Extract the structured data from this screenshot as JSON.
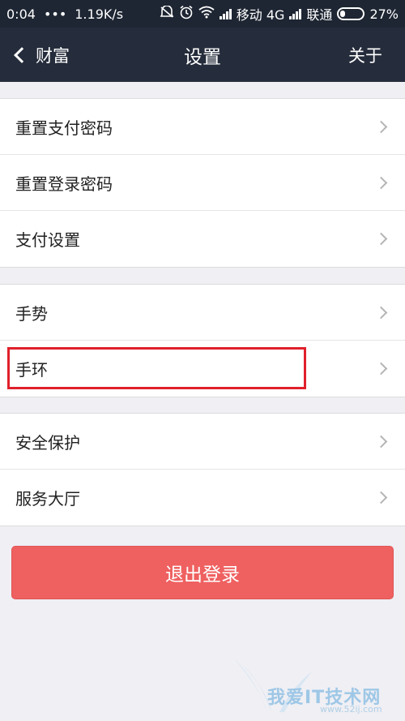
{
  "status_bar": {
    "time": "0:04",
    "dots": "•••",
    "speed": "1.19K/s",
    "carrier1": "移动 4G",
    "carrier2": "联通",
    "battery": "27%"
  },
  "nav": {
    "back_label": "财富",
    "title": "设置",
    "right_label": "关于"
  },
  "groups": [
    {
      "items": [
        {
          "label": "重置支付密码"
        },
        {
          "label": "重置登录密码"
        },
        {
          "label": "支付设置"
        }
      ]
    },
    {
      "items": [
        {
          "label": "手势"
        },
        {
          "label": "手环"
        }
      ]
    },
    {
      "items": [
        {
          "label": "安全保护"
        },
        {
          "label": "服务大厅"
        }
      ]
    }
  ],
  "logout_label": "退出登录",
  "watermark": {
    "text": "我爱IT技术网",
    "url": "www.52ij.com"
  },
  "colors": {
    "nav_bg": "#252c3b",
    "status_bg": "#1e2633",
    "page_bg": "#efeff4",
    "logout_bg": "#ef6060",
    "highlight": "#e0202b"
  }
}
